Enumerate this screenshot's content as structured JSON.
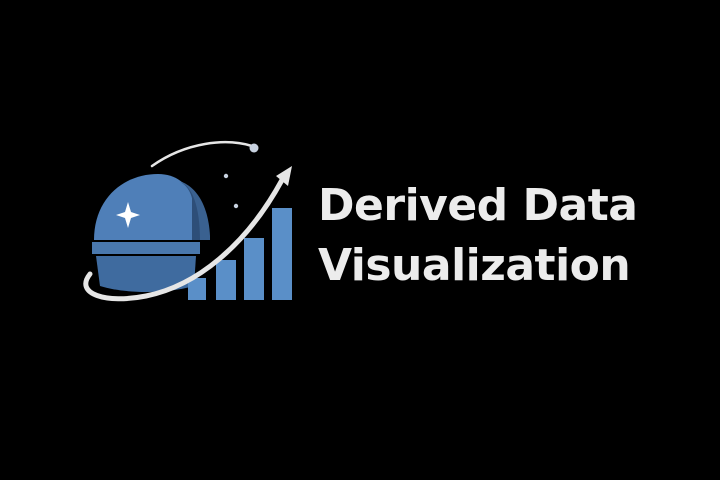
{
  "brand": {
    "name_line1": "Derived Data",
    "name_line2": "Visualization"
  },
  "colors": {
    "background": "#000000",
    "text": "#ececec",
    "dome_light": "#4f7fb8",
    "dome_dark": "#3a6190",
    "bar": "#5a8fc8",
    "orbit": "#e6e6e6"
  },
  "icons": {
    "dome": "observatory-dome-icon",
    "star": "sparkle-star-icon",
    "bars": "bar-chart-icon",
    "orbit": "orbit-arrow-icon"
  }
}
